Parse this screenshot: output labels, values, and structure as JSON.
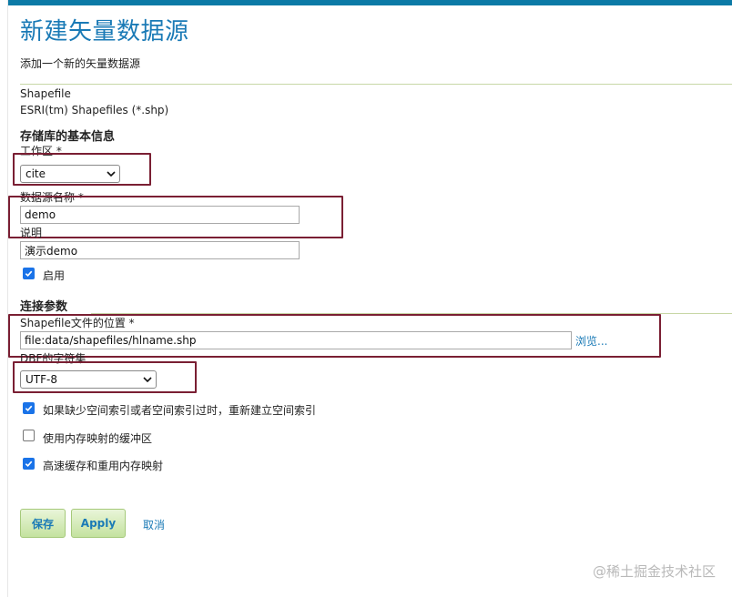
{
  "header": {
    "title": "新建矢量数据源",
    "description": "添加一个新的矢量数据源"
  },
  "datasource_type": {
    "name": "Shapefile",
    "description": "ESRI(tm) Shapefiles (*.shp)"
  },
  "basic_info": {
    "section_title": "存储库的基本信息",
    "workspace_label": "工作区 *",
    "workspace_value": "cite",
    "name_label": "数据源名称 *",
    "name_value": "demo",
    "desc_label": "说明",
    "desc_value": "演示demo",
    "enabled_label": "启用",
    "enabled": true
  },
  "connection": {
    "section_title": "连接参数",
    "location_label": "Shapefile文件的位置 *",
    "location_value": "file:data/shapefiles/hlname.shp",
    "browse_label": "浏览...",
    "charset_label": "DBF的字符集",
    "charset_value": "UTF-8",
    "options": [
      {
        "label": "如果缺少空间索引或者空间索引过时，重新建立空间索引",
        "checked": true
      },
      {
        "label": "使用内存映射的缓冲区",
        "checked": false
      },
      {
        "label": "高速缓存和重用内存映射",
        "checked": true
      }
    ]
  },
  "actions": {
    "save_label": "保存",
    "apply_label": "Apply",
    "cancel_label": "取消"
  },
  "watermark": "@稀土掘金技术社区",
  "colors": {
    "title": "#1a7ab6",
    "highlight": "#7a1f33",
    "checkbox": "#1a73e8",
    "top_bar": "#0c7aa6"
  }
}
